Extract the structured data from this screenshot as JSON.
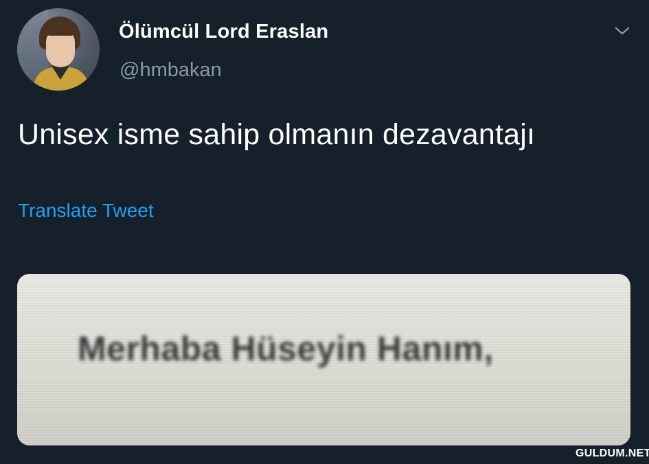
{
  "tweet": {
    "author_name": "Ölümcül Lord Eraslan",
    "author_handle": "@hmbakan",
    "text": "Unisex isme sahip olmanın dezavantajı",
    "translate_label": "Translate Tweet",
    "media_text": "Merhaba Hüseyin Hanım,"
  },
  "watermark": "GULDUM.NET",
  "icons": {
    "avatar": "profile-photo",
    "menu": "chevron-down-icon"
  },
  "colors": {
    "background": "#15202b",
    "link": "#1da1f2",
    "secondary_text": "#8899a6",
    "primary_text": "#ffffff"
  }
}
